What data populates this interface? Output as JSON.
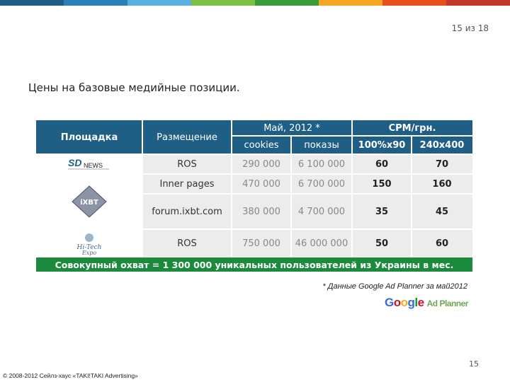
{
  "page_counter": "15 из 18",
  "title": "Цены на базовые медийные позиции.",
  "table": {
    "headers": {
      "platform": "Площадка",
      "placement": "Размещение",
      "may": "Май, 2012 *",
      "cookies": "cookies",
      "impressions": "показы",
      "cpm": "CPM/грн.",
      "cpm_a": "100%x90",
      "cpm_b": "240x400"
    },
    "rows": [
      {
        "logo": "SDNews",
        "placement": "ROS",
        "cookies": "290 000",
        "impressions": "6 100 000",
        "cpm_a": "60",
        "cpm_b": "70"
      },
      {
        "logo": "iXBT",
        "placement": "Inner pages",
        "cookies": "470 000",
        "impressions": "6 700 000",
        "cpm_a": "150",
        "cpm_b": "160"
      },
      {
        "logo": "",
        "placement": "forum.ixbt.com",
        "cookies": "380 000",
        "impressions": "4 700 000",
        "cpm_a": "35",
        "cpm_b": "45"
      },
      {
        "logo": "Hi-Tech Expo",
        "placement": "ROS",
        "cookies": "750 000",
        "impressions": "46 000 000",
        "cpm_a": "50",
        "cpm_b": "60"
      }
    ],
    "footer": "Совокупный охват = 1 300 000 уникальных пользователей из Украины в мес."
  },
  "note": "* Данные Google Ad Planner за май2012",
  "ad_planner_logo": {
    "google": "Google",
    "suffix": "Ad Planner"
  },
  "slide_number": "15",
  "copyright": "© 2008-2012 Сейлз-хаус «TAKI!TAKI Advertising»",
  "colors": {
    "header_blue": "#1f5f85",
    "footer_green": "#1c8a3c",
    "row_gray": "#ececec",
    "topbar": [
      "#1f5f85",
      "#2d7fb8",
      "#5ab0e0",
      "#7cc242",
      "#3a9a3a",
      "#f5a623",
      "#e94e1b",
      "#c0392b"
    ]
  }
}
